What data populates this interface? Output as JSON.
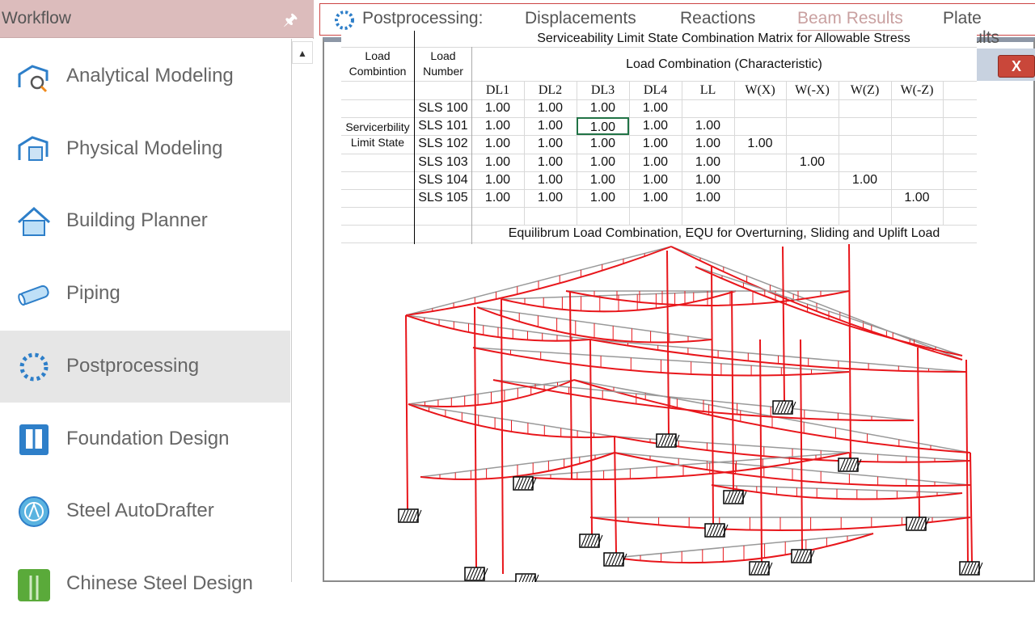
{
  "sidebar": {
    "title": "Workflow",
    "items": [
      {
        "label": "Analytical Modeling",
        "icon": "analytical-modeling-icon"
      },
      {
        "label": "Physical Modeling",
        "icon": "physical-modeling-icon"
      },
      {
        "label": "Building Planner",
        "icon": "house-icon"
      },
      {
        "label": "Piping",
        "icon": "pipe-icon"
      },
      {
        "label": "Postprocessing",
        "icon": "postprocessing-icon",
        "active": true
      },
      {
        "label": "Foundation Design",
        "icon": "foundation-icon"
      },
      {
        "label": "Steel AutoDrafter",
        "icon": "autodrafter-icon"
      },
      {
        "label": "Chinese Steel Design",
        "icon": "chinese-steel-icon"
      }
    ]
  },
  "tabs": {
    "title": "Postprocessing:",
    "items": [
      "Displacements",
      "Reactions",
      "Beam Results",
      "Plate Results"
    ],
    "active": "Beam Results"
  },
  "window": {
    "close": "X"
  },
  "table": {
    "title": "Serviceability Limit State Combination Matrix for Allowable Stress",
    "h_combination": "Load Combintion",
    "h_number": "Load Number",
    "h_group": "Load Combination (Characteristic)",
    "columns": [
      "DL1",
      "DL2",
      "DL3",
      "DL4",
      "LL",
      "W(X)",
      "W(-X)",
      "W(Z)",
      "W(-Z)"
    ],
    "group_label": "Servicerbility Limit State",
    "rows": [
      {
        "name": "SLS 100",
        "values": [
          "1.00",
          "1.00",
          "1.00",
          "1.00",
          "",
          "",
          "",
          "",
          ""
        ]
      },
      {
        "name": "SLS 101",
        "values": [
          "1.00",
          "1.00",
          "1.00",
          "1.00",
          "1.00",
          "",
          "",
          "",
          ""
        ]
      },
      {
        "name": "SLS 102",
        "values": [
          "1.00",
          "1.00",
          "1.00",
          "1.00",
          "1.00",
          "1.00",
          "",
          "",
          ""
        ]
      },
      {
        "name": "SLS 103",
        "values": [
          "1.00",
          "1.00",
          "1.00",
          "1.00",
          "1.00",
          "",
          "1.00",
          "",
          ""
        ]
      },
      {
        "name": "SLS 104",
        "values": [
          "1.00",
          "1.00",
          "1.00",
          "1.00",
          "1.00",
          "",
          "",
          "1.00",
          ""
        ]
      },
      {
        "name": "SLS 105",
        "values": [
          "1.00",
          "1.00",
          "1.00",
          "1.00",
          "1.00",
          "",
          "",
          "",
          "1.00"
        ]
      }
    ],
    "footer": "Equilibrum Load Combination, EQU for Overturning, Sliding and Uplift Load"
  },
  "colors": {
    "accent": "#dcbcbc",
    "model": "#e8161b",
    "selection": "#217346"
  }
}
